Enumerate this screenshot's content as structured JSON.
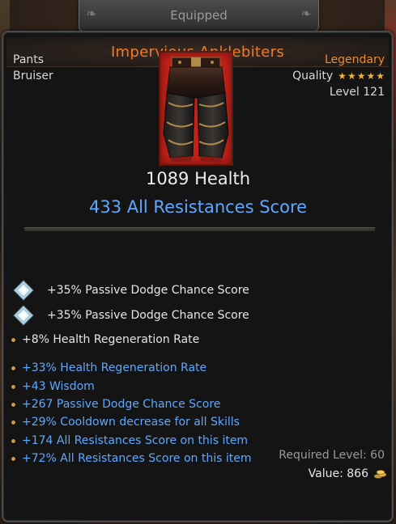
{
  "header": {
    "tab_label": "Equipped"
  },
  "item": {
    "name": "Impervious Anklebiters",
    "slot": "Pants",
    "class": "Bruiser",
    "rarity": "Legendary",
    "quality_label": "Quality",
    "quality_stars": 5,
    "level_label": "Level 121",
    "icon": "pants-icon"
  },
  "stats": {
    "primary": "1089 Health",
    "secondary": "433 All Resistances Score"
  },
  "gems": [
    {
      "icon": "diamond-gem-icon",
      "text": "+35% Passive Dodge Chance Score"
    },
    {
      "icon": "diamond-gem-icon",
      "text": "+35% Passive Dodge Chance Score"
    }
  ],
  "base_affixes": [
    {
      "text": "+8% Health Regeneration Rate"
    }
  ],
  "magic_affixes": [
    {
      "text": "+33% Health Regeneration Rate"
    },
    {
      "text": "+43 Wisdom"
    },
    {
      "text": "+267 Passive Dodge Chance Score"
    },
    {
      "text": "+29% Cooldown decrease for all Skills"
    },
    {
      "text": "+174 All Resistances Score on this item"
    },
    {
      "text": "+72% All Resistances Score on this item"
    }
  ],
  "footer": {
    "required_level": "Required Level: 60",
    "value": "Value: 866",
    "currency_icon": "gold-coins-icon"
  },
  "colors": {
    "title": "#f07a2a",
    "legendary": "#f08a32",
    "magic": "#5fa8ff",
    "text": "#e6e6e6",
    "muted": "#9a9a9a"
  }
}
